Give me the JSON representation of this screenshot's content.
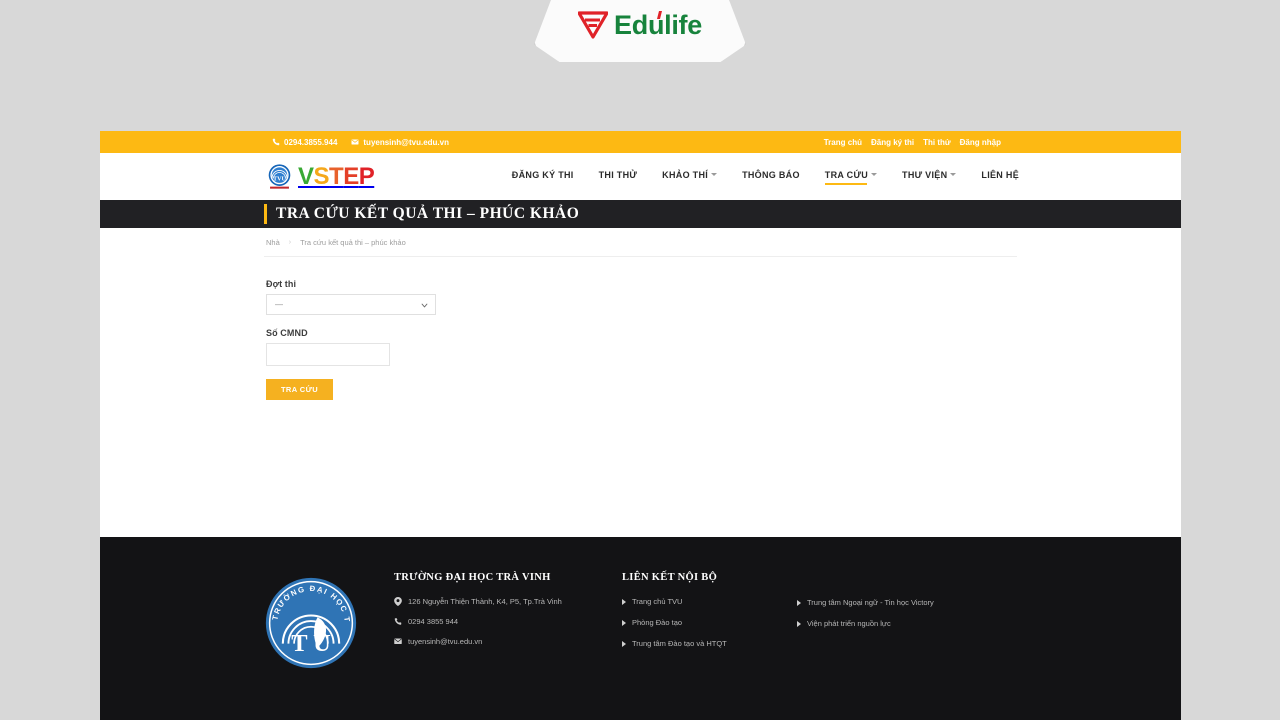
{
  "browser_chrome": {
    "brand_name": "Edulife",
    "brand_colors": {
      "green": "#17833c",
      "red": "#e02228"
    },
    "logo_icon": "edulife-triangle-f-icon"
  },
  "topbar": {
    "phone": "0294.3855.944",
    "phone_icon": "phone-icon",
    "email": "tuyensinh@tvu.edu.vn",
    "email_icon": "envelope-icon",
    "background": "#fdb913",
    "links": [
      {
        "label": "Trang chủ",
        "name": "topbar-link-home"
      },
      {
        "label": "Đăng ký thi",
        "name": "topbar-link-register"
      },
      {
        "label": "Thi thử",
        "name": "topbar-link-mocktest"
      },
      {
        "label": "Đăng nhập",
        "name": "topbar-link-login"
      }
    ]
  },
  "header": {
    "logo_seal_icon": "tvu-seal-icon",
    "wordmark": {
      "v": "V",
      "s": "S",
      "t": "T",
      "e": "E",
      "p": "P"
    },
    "wordmark_full": "VSTEP",
    "menu": [
      {
        "label": "ĐĂNG KÝ THI",
        "has_caret": false,
        "active": false
      },
      {
        "label": "THI THỬ",
        "has_caret": false,
        "active": false
      },
      {
        "label": "KHẢO THÍ",
        "has_caret": true,
        "active": false
      },
      {
        "label": "THÔNG BÁO",
        "has_caret": false,
        "active": false
      },
      {
        "label": "TRA CỨU",
        "has_caret": true,
        "active": true
      },
      {
        "label": "THƯ VIỆN",
        "has_caret": true,
        "active": false
      },
      {
        "label": "LIÊN HỆ",
        "has_caret": false,
        "active": false
      }
    ]
  },
  "page": {
    "title": "TRA CỨU KẾT QUẢ THI – PHÚC KHẢO",
    "title_accent_color": "#fdb913",
    "title_band_color": "#212124"
  },
  "breadcrumb": {
    "home": "Nhà",
    "separator": "›",
    "current": "Tra cứu kết quả thi – phúc khảo"
  },
  "form": {
    "exam_session": {
      "label": "Đợt thi",
      "selected_value": "—",
      "chevron_icon": "chevron-down-icon"
    },
    "id_number": {
      "label": "Số CMND",
      "value": "",
      "placeholder": ""
    },
    "submit": {
      "label": "TRA CỨU",
      "color": "#f5b120"
    }
  },
  "footer": {
    "background": "#131315",
    "seal_icon": "tvu-seal-icon",
    "seal_text": "TRƯỜNG ĐẠI HỌC TRÀ VINH",
    "seal_letters": "TVU",
    "university": {
      "heading": "TRƯỜNG ĐẠI HỌC TRÀ VINH",
      "address": "126 Nguyễn Thiện Thành, K4, P5, Tp.Trà Vinh",
      "address_icon": "map-pin-icon",
      "phone": "0294 3855 944",
      "phone_icon": "phone-icon",
      "email": "tuyensinh@tvu.edu.vn",
      "email_icon": "envelope-icon"
    },
    "internal_links": {
      "heading": "LIÊN KẾT NỘI BỘ",
      "items": [
        "Trang chủ TVU",
        "Phòng Đào tạo",
        "Trung tâm Đào tạo và HTQT"
      ]
    },
    "external_links": {
      "items": [
        "Trung tâm Ngoại ngữ - Tin học Victory",
        "Viện phát triển nguồn lực"
      ]
    }
  }
}
